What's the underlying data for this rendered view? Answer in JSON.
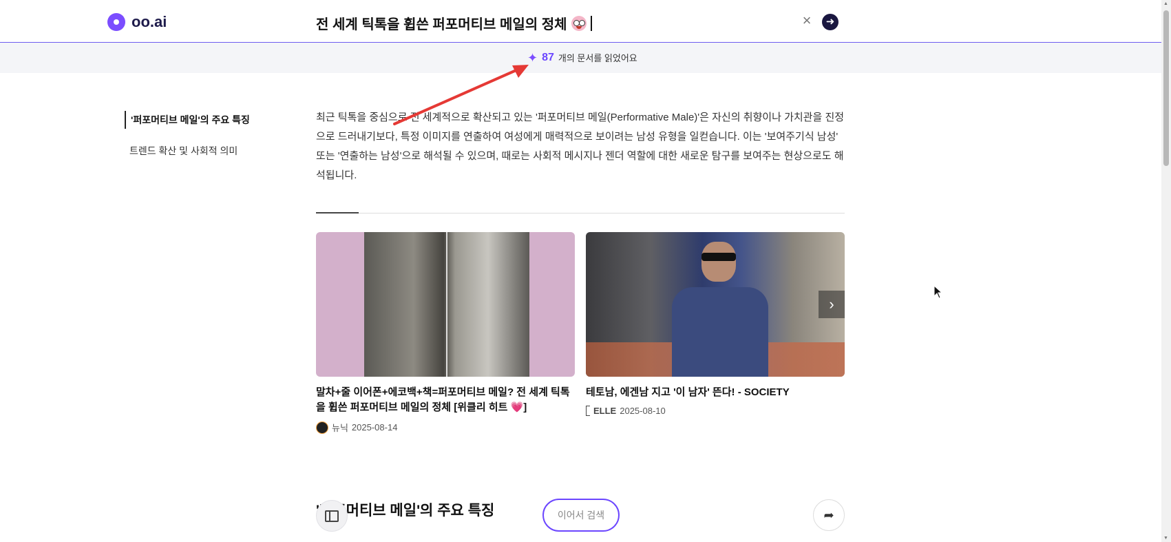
{
  "header": {
    "logo_text": "oo.ai",
    "query": "전 세계 틱톡을 휩쓴 퍼포머티브 메일의 정체",
    "clear_symbol": "×",
    "go_symbol": "➜"
  },
  "docs": {
    "sparkle": "✦",
    "count": "87",
    "text": "개의 문서를 읽었어요"
  },
  "toc": {
    "items": [
      {
        "label": "'퍼포머티브 메일'의 주요 특징"
      },
      {
        "label": "트렌드 확산 및 사회적 의미"
      }
    ]
  },
  "summary": "최근 틱톡을 중심으로 전 세계적으로 확산되고 있는 '퍼포머티브 메일(Performative Male)'은 자신의 취향이나 가치관을 진정으로 드러내기보다, 특정 이미지를 연출하여 여성에게 매력적으로 보이려는 남성 유형을 일컫습니다. 이는 '보여주기식 남성' 또는 '연출하는 남성'으로 해석될 수 있으며, 때로는 사회적 메시지나 젠더 역할에 대한 새로운 탐구를 보여주는 현상으로도 해석됩니다.",
  "cards": [
    {
      "title": "말차+줄 이어폰+에코백+책=퍼포머티브 메일? 전 세계 틱톡을 휩쓴 퍼포머티브 메일의 정체 [위클리 히트 💗]",
      "source": "뉴닉",
      "date": "2025-08-14"
    },
    {
      "title": "테토남, 에겐남 지고 '이 남자' 뜬다! - SOCIETY",
      "source": "ELLE",
      "date": "2025-08-10",
      "next_symbol": "›"
    }
  ],
  "bottom": {
    "section_heading": "'퍼포머티브 메일'의 주요 특징",
    "continue_label": "이어서 검색",
    "share_symbol": "➦"
  },
  "colors": {
    "accent": "#6b46ff",
    "logo": "#7b4dff",
    "annotation_arrow": "#e53935"
  }
}
